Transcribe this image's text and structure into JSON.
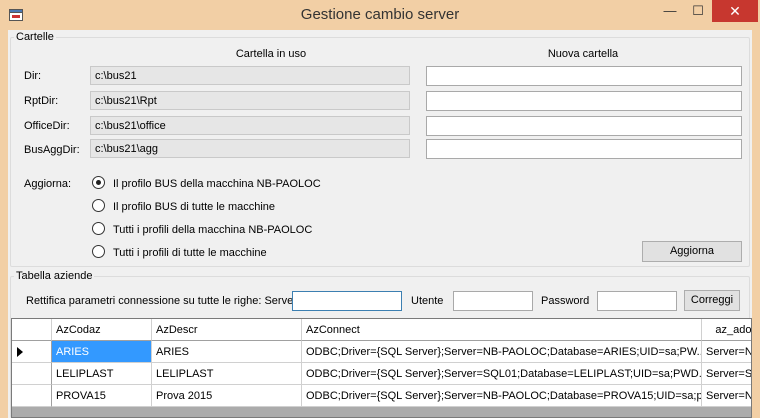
{
  "window": {
    "title": "Gestione cambio server",
    "controls": {
      "minimize": "—",
      "maximize": "☐",
      "close": "✕"
    }
  },
  "cartelle": {
    "group_title": "Cartelle",
    "header_current": "Cartella in uso",
    "header_new": "Nuova cartella",
    "rows": [
      {
        "label": "Dir:",
        "current": "c:\\bus21",
        "new": ""
      },
      {
        "label": "RptDir:",
        "current": "c:\\bus21\\Rpt",
        "new": ""
      },
      {
        "label": "OfficeDir:",
        "current": "c:\\bus21\\office",
        "new": ""
      },
      {
        "label": "BusAggDir:",
        "current": "c:\\bus21\\agg",
        "new": ""
      }
    ],
    "aggiorna_label": "Aggiorna:",
    "options": [
      {
        "label": "Il profilo BUS della macchina NB-PAOLOC",
        "checked": true
      },
      {
        "label": "Il profilo BUS di tutte le macchine",
        "checked": false
      },
      {
        "label": "Tutti i profili della macchina NB-PAOLOC",
        "checked": false
      },
      {
        "label": "Tutti i profili di tutte le macchine",
        "checked": false
      }
    ],
    "aggiorna_button": "Aggiorna"
  },
  "aziende": {
    "group_title": "Tabella aziende",
    "rettifica_label": "Rettifica parametri connessione su tutte le righe: Server",
    "server_value": "",
    "utente_label": "Utente",
    "utente_value": "",
    "password_label": "Password",
    "password_value": "",
    "correggi_button": "Correggi"
  },
  "grid": {
    "columns": [
      "AzCodaz",
      "AzDescr",
      "AzConnect",
      "az_adoc"
    ],
    "rows": [
      {
        "current": true,
        "cells": [
          "ARIES",
          "ARIES",
          "ODBC;Driver={SQL Server};Server=NB-PAOLOC;Database=ARIES;UID=sa;PW...",
          "Server=N"
        ]
      },
      {
        "current": false,
        "cells": [
          "LELIPLAST",
          "LELIPLAST",
          "ODBC;Driver={SQL Server};Server=SQL01;Database=LELIPLAST;UID=sa;PWD...",
          "Server=S"
        ]
      },
      {
        "current": false,
        "cells": [
          "PROVA15",
          "Prova 2015",
          "ODBC;Driver={SQL Server};Server=NB-PAOLOC;Database=PROVA15;UID=sa;p...",
          "Server=N"
        ]
      }
    ]
  },
  "colors": {
    "titlebar": "#f2cfa5",
    "selection": "#3399ff",
    "close": "#c7372f"
  }
}
